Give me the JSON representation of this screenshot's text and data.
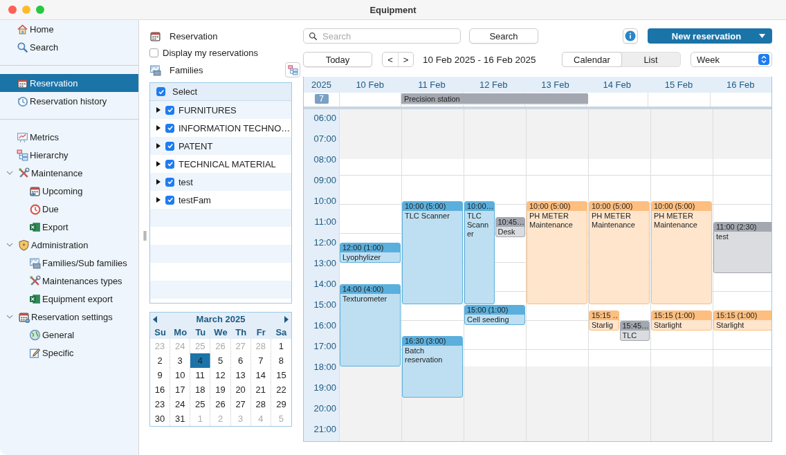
{
  "window": {
    "title": "Equipment"
  },
  "sidebar": {
    "sections": [
      {
        "items": [
          {
            "label": "Home",
            "selected": false
          },
          {
            "label": "Search",
            "selected": false
          }
        ]
      },
      {
        "items": [
          {
            "label": "Reservation",
            "selected": true
          },
          {
            "label": "Reservation history",
            "selected": false
          }
        ]
      },
      {
        "items": [
          {
            "label": "Metrics",
            "selected": false
          },
          {
            "label": "Hierarchy",
            "selected": false
          },
          {
            "label": "Maintenance",
            "selected": false,
            "expanded": true,
            "children": [
              {
                "label": "Upcoming",
                "selected": false
              },
              {
                "label": "Due",
                "selected": false
              },
              {
                "label": "Export",
                "selected": false
              }
            ]
          },
          {
            "label": "Administration",
            "selected": false,
            "expanded": true,
            "children": [
              {
                "label": "Families/Sub families",
                "selected": false
              },
              {
                "label": "Maintenances types",
                "selected": false
              },
              {
                "label": "Equipment export",
                "selected": false
              }
            ]
          },
          {
            "label": "Reservation settings",
            "selected": false,
            "expanded": true,
            "children": [
              {
                "label": "General",
                "selected": false
              },
              {
                "label": "Specific",
                "selected": false
              }
            ]
          }
        ]
      }
    ]
  },
  "filters": {
    "title": "Reservation",
    "my_reservations": {
      "label": "Display my reservations",
      "checked": false
    },
    "families": {
      "title": "Families",
      "select_all": {
        "label": "Select",
        "checked": true
      },
      "items": [
        {
          "label": "FURNITURES",
          "checked": true,
          "expanded": false
        },
        {
          "label": "INFORMATION TECHNO…",
          "checked": true,
          "expanded": false
        },
        {
          "label": "PATENT",
          "checked": true,
          "expanded": false
        },
        {
          "label": "TECHNICAL MATERIAL",
          "checked": true,
          "expanded": false
        },
        {
          "label": "test",
          "checked": true,
          "expanded": false
        },
        {
          "label": "testFam",
          "checked": true,
          "expanded": false
        }
      ]
    }
  },
  "mini_calendar": {
    "title": "March 2025",
    "weekdays": [
      "Su",
      "Mo",
      "Tu",
      "We",
      "Th",
      "Fr",
      "Sa"
    ],
    "weeks": [
      [
        {
          "day": "23",
          "in_month": false,
          "selected": false
        },
        {
          "day": "24",
          "in_month": false,
          "selected": false
        },
        {
          "day": "25",
          "in_month": false,
          "selected": false
        },
        {
          "day": "26",
          "in_month": false,
          "selected": false
        },
        {
          "day": "27",
          "in_month": false,
          "selected": false
        },
        {
          "day": "28",
          "in_month": false,
          "selected": false
        },
        {
          "day": "1",
          "in_month": true,
          "selected": false
        }
      ],
      [
        {
          "day": "2",
          "in_month": true,
          "selected": false
        },
        {
          "day": "3",
          "in_month": true,
          "selected": false
        },
        {
          "day": "4",
          "in_month": true,
          "selected": true
        },
        {
          "day": "5",
          "in_month": true,
          "selected": false
        },
        {
          "day": "6",
          "in_month": true,
          "selected": false
        },
        {
          "day": "7",
          "in_month": true,
          "selected": false
        },
        {
          "day": "8",
          "in_month": true,
          "selected": false
        }
      ],
      [
        {
          "day": "9",
          "in_month": true,
          "selected": false
        },
        {
          "day": "10",
          "in_month": true,
          "selected": false
        },
        {
          "day": "11",
          "in_month": true,
          "selected": false
        },
        {
          "day": "12",
          "in_month": true,
          "selected": false
        },
        {
          "day": "13",
          "in_month": true,
          "selected": false
        },
        {
          "day": "14",
          "in_month": true,
          "selected": false
        },
        {
          "day": "15",
          "in_month": true,
          "selected": false
        }
      ],
      [
        {
          "day": "16",
          "in_month": true,
          "selected": false
        },
        {
          "day": "17",
          "in_month": true,
          "selected": false
        },
        {
          "day": "18",
          "in_month": true,
          "selected": false
        },
        {
          "day": "19",
          "in_month": true,
          "selected": false
        },
        {
          "day": "20",
          "in_month": true,
          "selected": false
        },
        {
          "day": "21",
          "in_month": true,
          "selected": false
        },
        {
          "day": "22",
          "in_month": true,
          "selected": false
        }
      ],
      [
        {
          "day": "23",
          "in_month": true,
          "selected": false
        },
        {
          "day": "24",
          "in_month": true,
          "selected": false
        },
        {
          "day": "25",
          "in_month": true,
          "selected": false
        },
        {
          "day": "26",
          "in_month": true,
          "selected": false
        },
        {
          "day": "27",
          "in_month": true,
          "selected": false
        },
        {
          "day": "28",
          "in_month": true,
          "selected": false
        },
        {
          "day": "29",
          "in_month": true,
          "selected": false
        }
      ],
      [
        {
          "day": "30",
          "in_month": true,
          "selected": false
        },
        {
          "day": "31",
          "in_month": true,
          "selected": false
        },
        {
          "day": "1",
          "in_month": false,
          "selected": false
        },
        {
          "day": "2",
          "in_month": false,
          "selected": false
        },
        {
          "day": "3",
          "in_month": false,
          "selected": false
        },
        {
          "day": "4",
          "in_month": false,
          "selected": false
        },
        {
          "day": "5",
          "in_month": false,
          "selected": false
        }
      ]
    ]
  },
  "toolbar": {
    "search": {
      "placeholder": "Search"
    },
    "search_button": "Search",
    "new_button": "New reservation",
    "today_button": "Today",
    "prev": "<",
    "next": ">",
    "range": "10 Feb 2025 - 16 Feb 2025",
    "views": [
      {
        "label": "Calendar",
        "selected": true
      },
      {
        "label": "List",
        "selected": false
      }
    ],
    "period": "Week"
  },
  "calendar": {
    "year": "2025",
    "week": "7",
    "all_day": [
      {
        "title": "Precision station",
        "color": "#a2a7b0"
      }
    ],
    "hours": [
      "06:00",
      "07:00",
      "08:00",
      "09:00",
      "10:00",
      "11:00",
      "12:00",
      "13:00",
      "14:00",
      "15:00",
      "16:00",
      "17:00",
      "18:00",
      "19:00",
      "20:00",
      "21:00"
    ],
    "days": [
      {
        "label": "10 Feb",
        "events": [
          {
            "time": "12:00 (1:00)",
            "title": "Lyophylizer",
            "color": "#5aafdc"
          },
          {
            "time": "14:00 (4:00)",
            "title": "Texturometer",
            "color": "#5aafdc"
          }
        ]
      },
      {
        "label": "11 Feb",
        "events": [
          {
            "time": "10:00 (5:00)",
            "title": "TLC Scanner",
            "color": "#5aafdc"
          },
          {
            "time": "16:30 (3:00)",
            "title": "Batch reservation",
            "color": "#5aafdc"
          }
        ]
      },
      {
        "label": "12 Feb",
        "events": [
          {
            "time": "10:00…",
            "title": "TLC Scanner",
            "color": "#5aafdc"
          },
          {
            "time": "10:45…",
            "title": "Desk",
            "color": "#a2a7b0"
          },
          {
            "time": "15:00 (1:00)",
            "title": "Cell seeding",
            "color": "#5aafdc"
          }
        ]
      },
      {
        "label": "13 Feb",
        "events": [
          {
            "time": "10:00 (5:00)",
            "title": "PH METER Maintenance",
            "color": "#fdbe7f"
          }
        ]
      },
      {
        "label": "14 Feb",
        "events": [
          {
            "time": "10:00 (5:00)",
            "title": "PH METER Maintenance",
            "color": "#fdbe7f"
          },
          {
            "time": "15:15 …",
            "title": "Starlig",
            "color": "#fdbe7f"
          },
          {
            "time": "15:45…",
            "title": "TLC",
            "color": "#a2a7b0"
          }
        ]
      },
      {
        "label": "15 Feb",
        "events": [
          {
            "time": "10:00 (5:00)",
            "title": "PH METER Maintenance",
            "color": "#fdbe7f"
          },
          {
            "time": "15:15 (1:00)",
            "title": "Starlight",
            "color": "#fdbe7f"
          }
        ]
      },
      {
        "label": "16 Feb",
        "events": [
          {
            "time": "11:00 (2:30)",
            "title": "test",
            "color": "#a2a7b0"
          },
          {
            "time": "15:15 (1:00)",
            "title": "Starlight",
            "color": "#fdbe7f"
          }
        ]
      }
    ]
  }
}
